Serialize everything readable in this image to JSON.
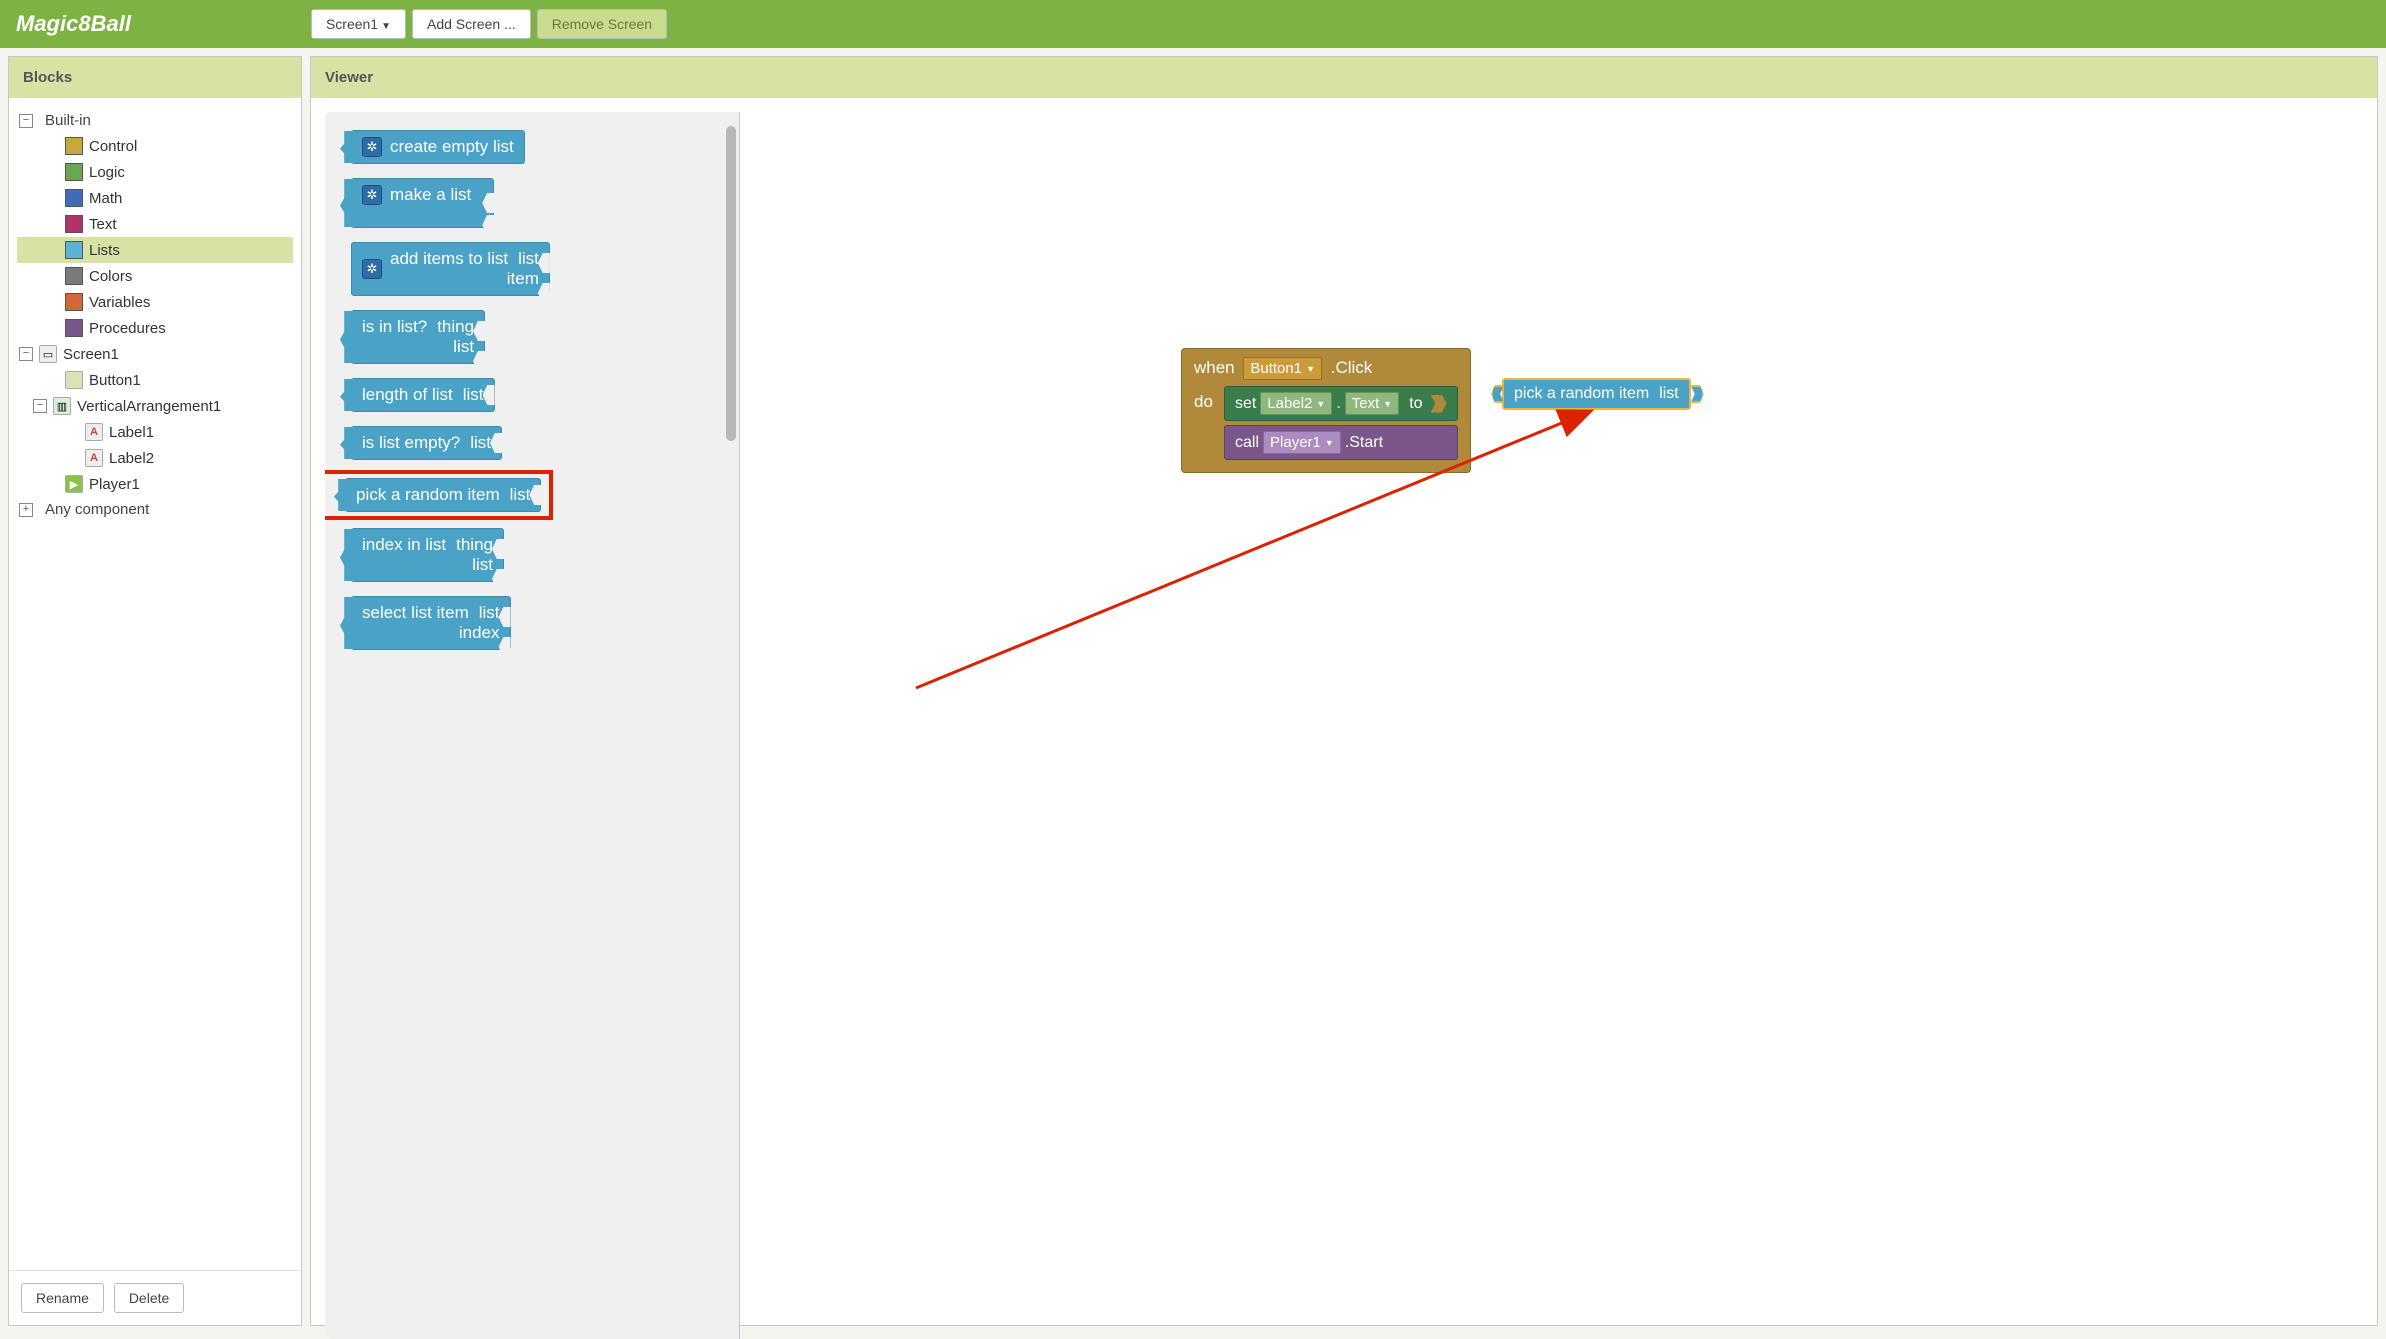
{
  "app_title": "Magic8Ball",
  "toolbar": {
    "screen_selector": "Screen1",
    "add_screen": "Add Screen ...",
    "remove_screen": "Remove Screen"
  },
  "panels": {
    "blocks": "Blocks",
    "viewer": "Viewer"
  },
  "tree": {
    "built_in": "Built-in",
    "categories": [
      {
        "label": "Control",
        "color": "#c6a93a"
      },
      {
        "label": "Logic",
        "color": "#6aa84f"
      },
      {
        "label": "Math",
        "color": "#3d6db5"
      },
      {
        "label": "Text",
        "color": "#b0336a"
      },
      {
        "label": "Lists",
        "color": "#5ab3d1"
      },
      {
        "label": "Colors",
        "color": "#7a7a7a"
      },
      {
        "label": "Variables",
        "color": "#d1683a"
      },
      {
        "label": "Procedures",
        "color": "#7a578a"
      }
    ],
    "screen": "Screen1",
    "components": {
      "button": "Button1",
      "vertical": "VerticalArrangement1",
      "label1": "Label1",
      "label2": "Label2",
      "player": "Player1"
    },
    "any_component": "Any component"
  },
  "footer": {
    "rename": "Rename",
    "delete": "Delete"
  },
  "palette_blocks": {
    "create_empty": "create empty list",
    "make_list": "make a list",
    "add_items": "add items to list",
    "add_items_p1": "list",
    "add_items_p2": "item",
    "is_in_list": "is in list?",
    "is_in_p1": "thing",
    "is_in_p2": "list",
    "length_of": "length of list",
    "length_p": "list",
    "is_empty": "is list empty?",
    "is_empty_p": "list",
    "pick_random": "pick a random item",
    "pick_p": "list",
    "index_in": "index in list",
    "index_p1": "thing",
    "index_p2": "list",
    "select_item": "select list item",
    "select_p1": "list",
    "select_p2": "index"
  },
  "workspace": {
    "when": "when",
    "button_dd": "Button1",
    "click": ".Click",
    "do": "do",
    "set": "set",
    "label_dd": "Label2",
    "dot": ".",
    "text_dd": "Text",
    "to": "to",
    "call": "call",
    "player_dd": "Player1",
    "start": ".Start",
    "pick_random": "pick a random item",
    "pick_list": "list"
  }
}
